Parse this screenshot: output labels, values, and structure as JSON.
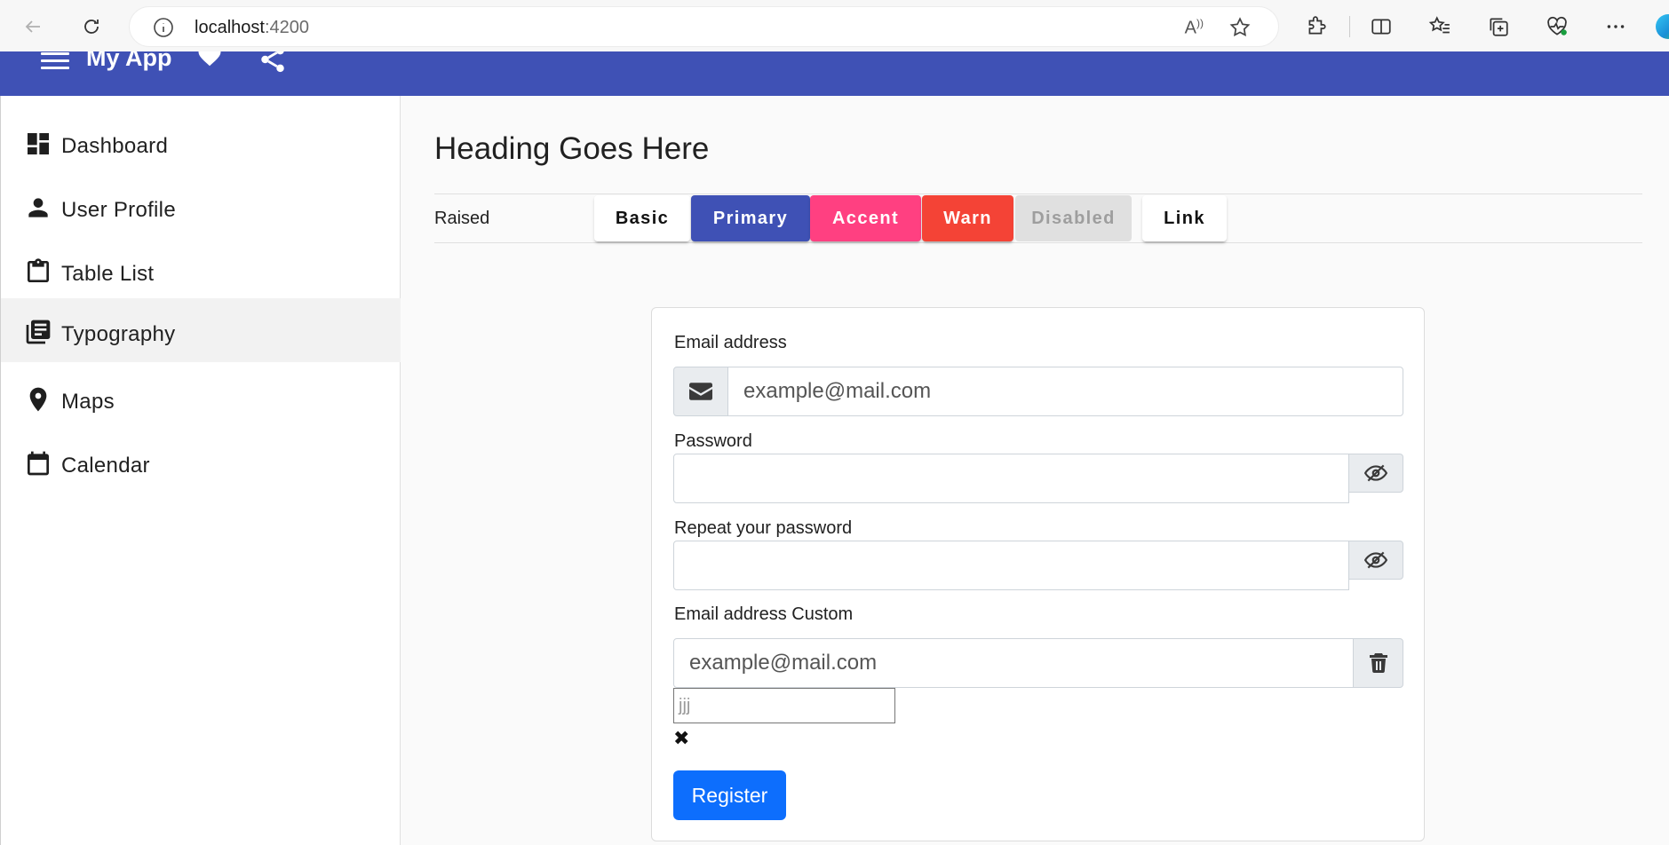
{
  "browser": {
    "url_host": "localhost",
    "url_port": ":4200",
    "read_aloud": "A̅"
  },
  "toolbar": {
    "title": "My App"
  },
  "sidebar": {
    "items": [
      {
        "label": "Dashboard",
        "icon": "dashboard-icon"
      },
      {
        "label": "User Profile",
        "icon": "person-icon"
      },
      {
        "label": "Table List",
        "icon": "clipboard-icon"
      },
      {
        "label": "Typography",
        "icon": "library-books-icon",
        "active": true
      },
      {
        "label": "Maps",
        "icon": "location-pin-icon"
      },
      {
        "label": "Calendar",
        "icon": "calendar-icon"
      }
    ]
  },
  "main": {
    "heading": "Heading Goes Here",
    "raised_label": "Raised",
    "buttons": {
      "basic": "Basic",
      "primary": "Primary",
      "accent": "Accent",
      "warn": "Warn",
      "disabled": "Disabled",
      "link": "Link"
    }
  },
  "form": {
    "email_label": "Email address",
    "email_placeholder": "example@mail.com",
    "password_label": "Password",
    "repeat_password_label": "Repeat your password",
    "custom_email_label": "Email address Custom",
    "custom_email_placeholder": "example@mail.com",
    "small_input_value": "jjj",
    "clear_symbol": "✖",
    "register_label": "Register"
  },
  "colors": {
    "primary": "#3f51b5",
    "accent": "#ff4081",
    "warn": "#f44336",
    "register": "#0d6efd"
  }
}
